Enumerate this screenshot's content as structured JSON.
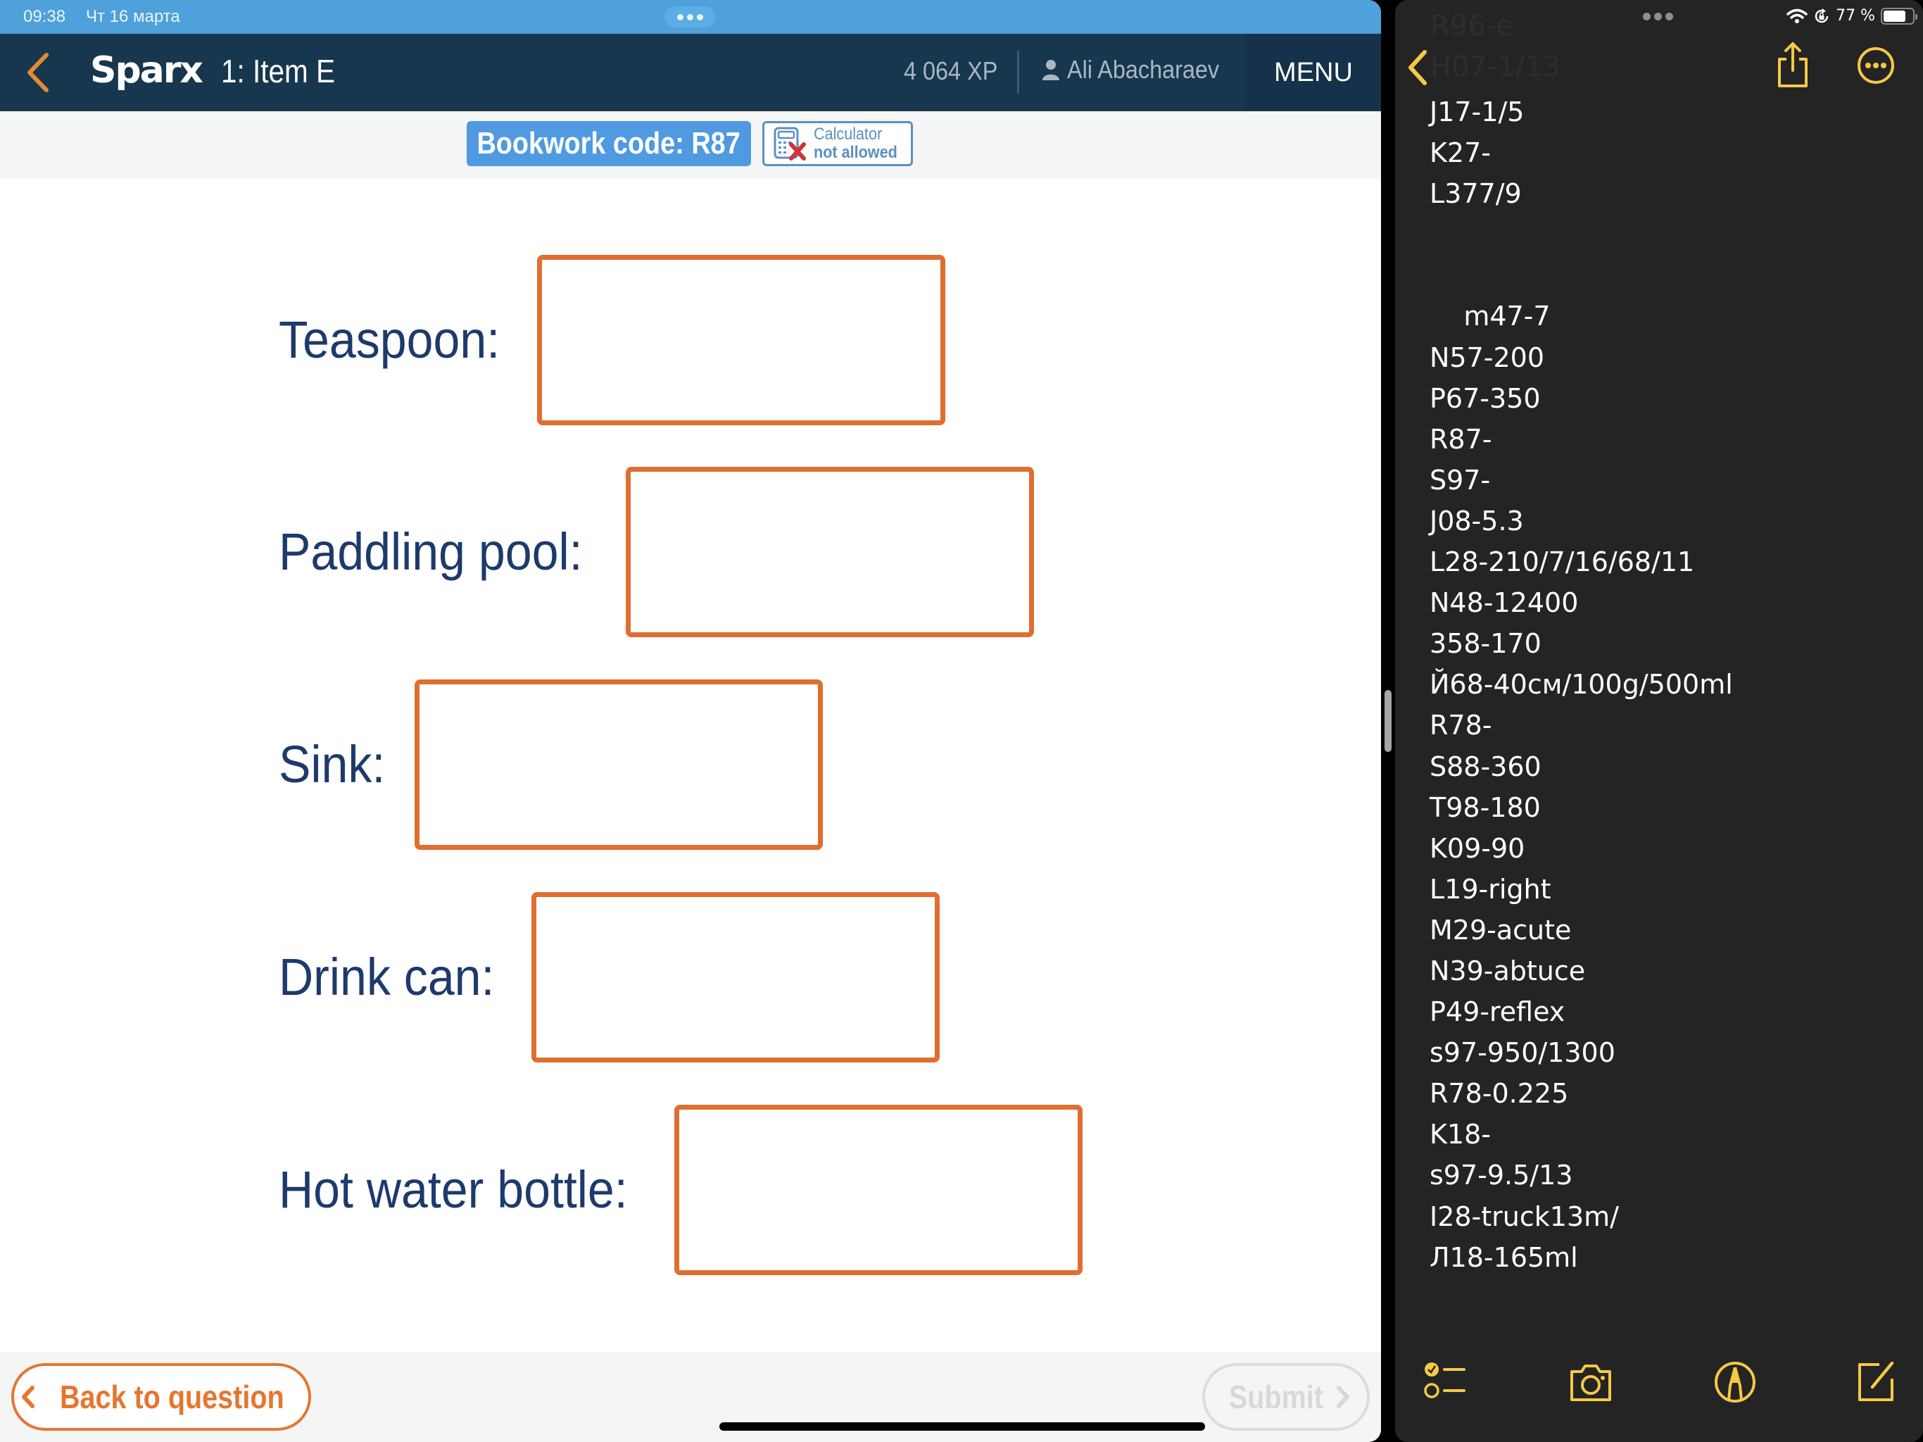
{
  "left_status_bar": {
    "time": "09:38",
    "date": "Чт 16 марта"
  },
  "app_header": {
    "brand": "Sparx",
    "item_title": "1: Item E",
    "xp": "4 064 XP",
    "user_name": "Ali Abacharaev",
    "menu_label": "MENU"
  },
  "subheader": {
    "bookwork_code": "Bookwork code: R87",
    "calculator_line1": "Calculator",
    "calculator_line2": "not allowed"
  },
  "questions": [
    {
      "label": "Teaspoon:",
      "value": ""
    },
    {
      "label": "Paddling pool:",
      "value": ""
    },
    {
      "label": "Sink:",
      "value": ""
    },
    {
      "label": "Drink can:",
      "value": ""
    },
    {
      "label": "Hot water bottle:",
      "value": ""
    }
  ],
  "footer": {
    "back_label": "Back to question",
    "submit_label": "Submit"
  },
  "right_status_bar": {
    "battery_percent": "77 %",
    "battery_level": 0.77
  },
  "notes": {
    "faded_lines": [
      "R96-e",
      "H07-1/13"
    ],
    "lines": [
      "J17-1/5",
      "K27-",
      "L377/9",
      "",
      "",
      "    m47-7",
      "N57-200",
      "P67-350",
      "R87-",
      "S97-",
      "J08-5.3",
      "L28-210/7/16/68/11",
      "N48-12400",
      "358-170",
      "Й68-40см/100g/500ml",
      "R78-",
      "S88-360",
      "T98-180",
      "K09-90",
      "L19-right",
      "M29-acute",
      "N39-abtuce",
      "P49-reflex",
      "s97-950/1300",
      "R78-0.225",
      "K18-",
      "s97-9.5/13",
      "I28-truck13m/",
      "Л18-165ml"
    ]
  },
  "colors": {
    "sparx_header": "#17374f",
    "status_blue": "#4ea1da",
    "accent_orange": "#df6e2f",
    "label_navy": "#1d3a6c",
    "notes_yellow": "#f5c945",
    "notes_bg": "#242424"
  }
}
